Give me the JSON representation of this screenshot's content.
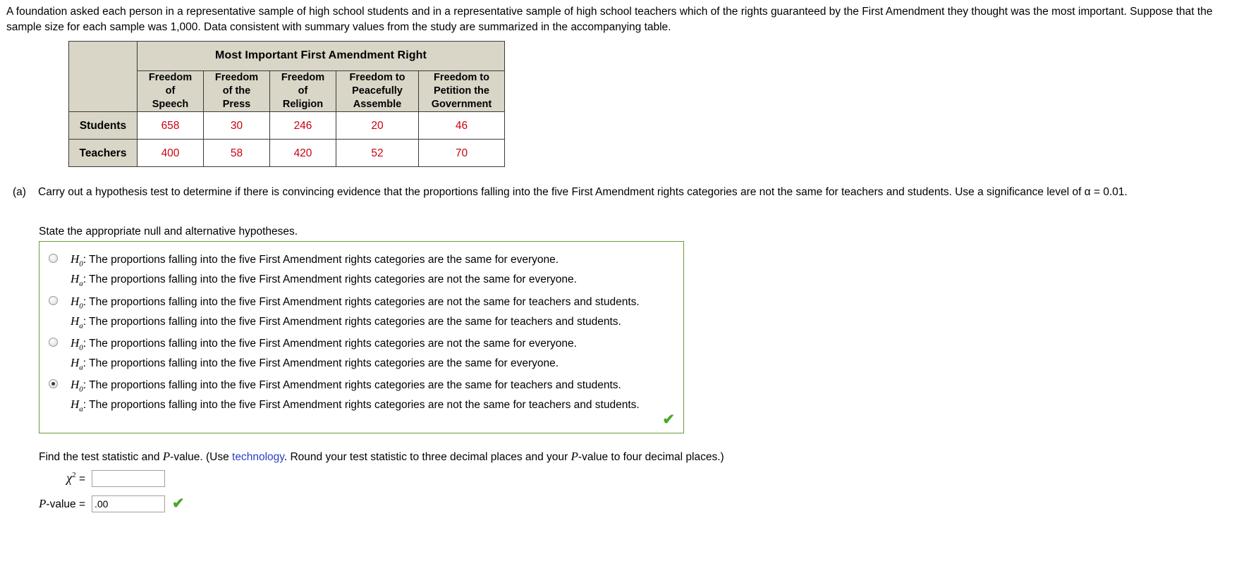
{
  "intro": {
    "text": "A foundation asked each person in a representative sample of high school students and in a representative sample of high school teachers which of the rights guaranteed by the First Amendment they thought was the most important. Suppose that the sample size for each sample was 1,000. Data consistent with summary values from the study are summarized in the accompanying table."
  },
  "table": {
    "group_header": "Most Important First Amendment Right",
    "columns": [
      "Freedom\nof\nSpeech",
      "Freedom\nof the\nPress",
      "Freedom\nof\nReligion",
      "Freedom to\nPeacefully\nAssemble",
      "Freedom to\nPetition the\nGovernment"
    ],
    "rows": [
      {
        "label": "Students",
        "values": [
          "658",
          "30",
          "246",
          "20",
          "46"
        ]
      },
      {
        "label": "Teachers",
        "values": [
          "400",
          "58",
          "420",
          "52",
          "70"
        ]
      }
    ],
    "value_color": "#cc0011",
    "header_bg": "#d9d5c7"
  },
  "part_a": {
    "tag": "(a)",
    "text": "Carry out a hypothesis test to determine if there is convincing evidence that the proportions falling into the five First Amendment rights categories are not the same for teachers and students. Use a significance level of α = 0.01.",
    "state_prompt": "State the appropriate null and alternative hypotheses."
  },
  "options": {
    "items": [
      {
        "selected": false,
        "null_symbol": "H",
        "null_sub": "0",
        "null_text": ": The proportions falling into the five First Amendment rights categories are the same for everyone.",
        "alt_symbol": "H",
        "alt_sub": "a",
        "alt_text": ": The proportions falling into the five First Amendment rights categories are not the same for everyone."
      },
      {
        "selected": false,
        "null_symbol": "H",
        "null_sub": "0",
        "null_text": ": The proportions falling into the five First Amendment rights categories are not the same for teachers and students.",
        "alt_symbol": "H",
        "alt_sub": "a",
        "alt_text": ": The proportions falling into the five First Amendment rights categories are the same for teachers and students."
      },
      {
        "selected": false,
        "null_symbol": "H",
        "null_sub": "0",
        "null_text": ": The proportions falling into the five First Amendment rights categories are not the same for everyone.",
        "alt_symbol": "H",
        "alt_sub": "a",
        "alt_text": ": The proportions falling into the five First Amendment rights categories are the same for everyone."
      },
      {
        "selected": true,
        "null_symbol": "H",
        "null_sub": "0",
        "null_text": ": The proportions falling into the five First Amendment rights categories are the same for teachers and students.",
        "alt_symbol": "H",
        "alt_sub": "a",
        "alt_text": ": The proportions falling into the five First Amendment rights categories are not the same for teachers and students."
      }
    ],
    "correct_mark": "✔",
    "border_color": "#6a9a3b",
    "mark_color": "#4ca72c"
  },
  "find": {
    "text_part1": "Find the test statistic and ",
    "p_italic": "P",
    "text_part2": "-value. (Use ",
    "link": "technology",
    "text_part3": ". Round your test statistic to three decimal places and your ",
    "p_italic2": "P",
    "text_part4": "-value to four decimal places.)",
    "link_color": "#2b3fc4"
  },
  "answers": {
    "chi_symbol": "χ",
    "chi_sup": "2",
    "chi_equals": " = ",
    "chi_value": "",
    "chi_placeholder": "",
    "p_label_italic": "P",
    "p_label_rest": "-value  = ",
    "p_value": ".00",
    "p_placeholder": "",
    "mark": "✔"
  }
}
